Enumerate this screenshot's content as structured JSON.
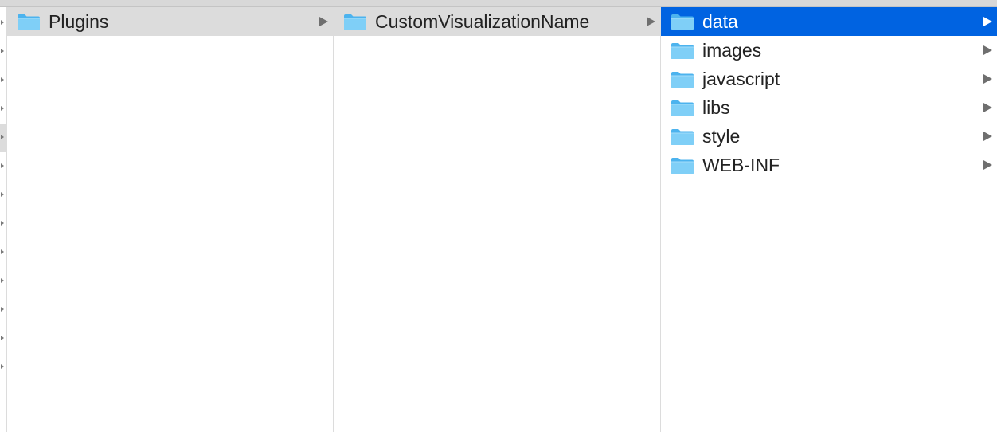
{
  "columns": [
    {
      "items": [
        {
          "label": "Plugins",
          "state": "path",
          "icon": "folder-icon"
        }
      ]
    },
    {
      "items": [
        {
          "label": "CustomVisualizationName",
          "state": "path",
          "icon": "folder-icon"
        }
      ]
    },
    {
      "items": [
        {
          "label": "data",
          "state": "selected",
          "icon": "folder-icon"
        },
        {
          "label": "images",
          "state": "normal",
          "icon": "folder-icon"
        },
        {
          "label": "javascript",
          "state": "normal",
          "icon": "folder-icon"
        },
        {
          "label": "libs",
          "state": "normal",
          "icon": "folder-icon"
        },
        {
          "label": "style",
          "state": "normal",
          "icon": "folder-icon"
        },
        {
          "label": "WEB-INF",
          "state": "normal",
          "icon": "folder-icon"
        }
      ]
    }
  ],
  "colors": {
    "selection": "#0063e1",
    "path_highlight": "#dcdcdc",
    "folder_light": "#7fcff7",
    "folder_dark": "#4cb3ee"
  }
}
